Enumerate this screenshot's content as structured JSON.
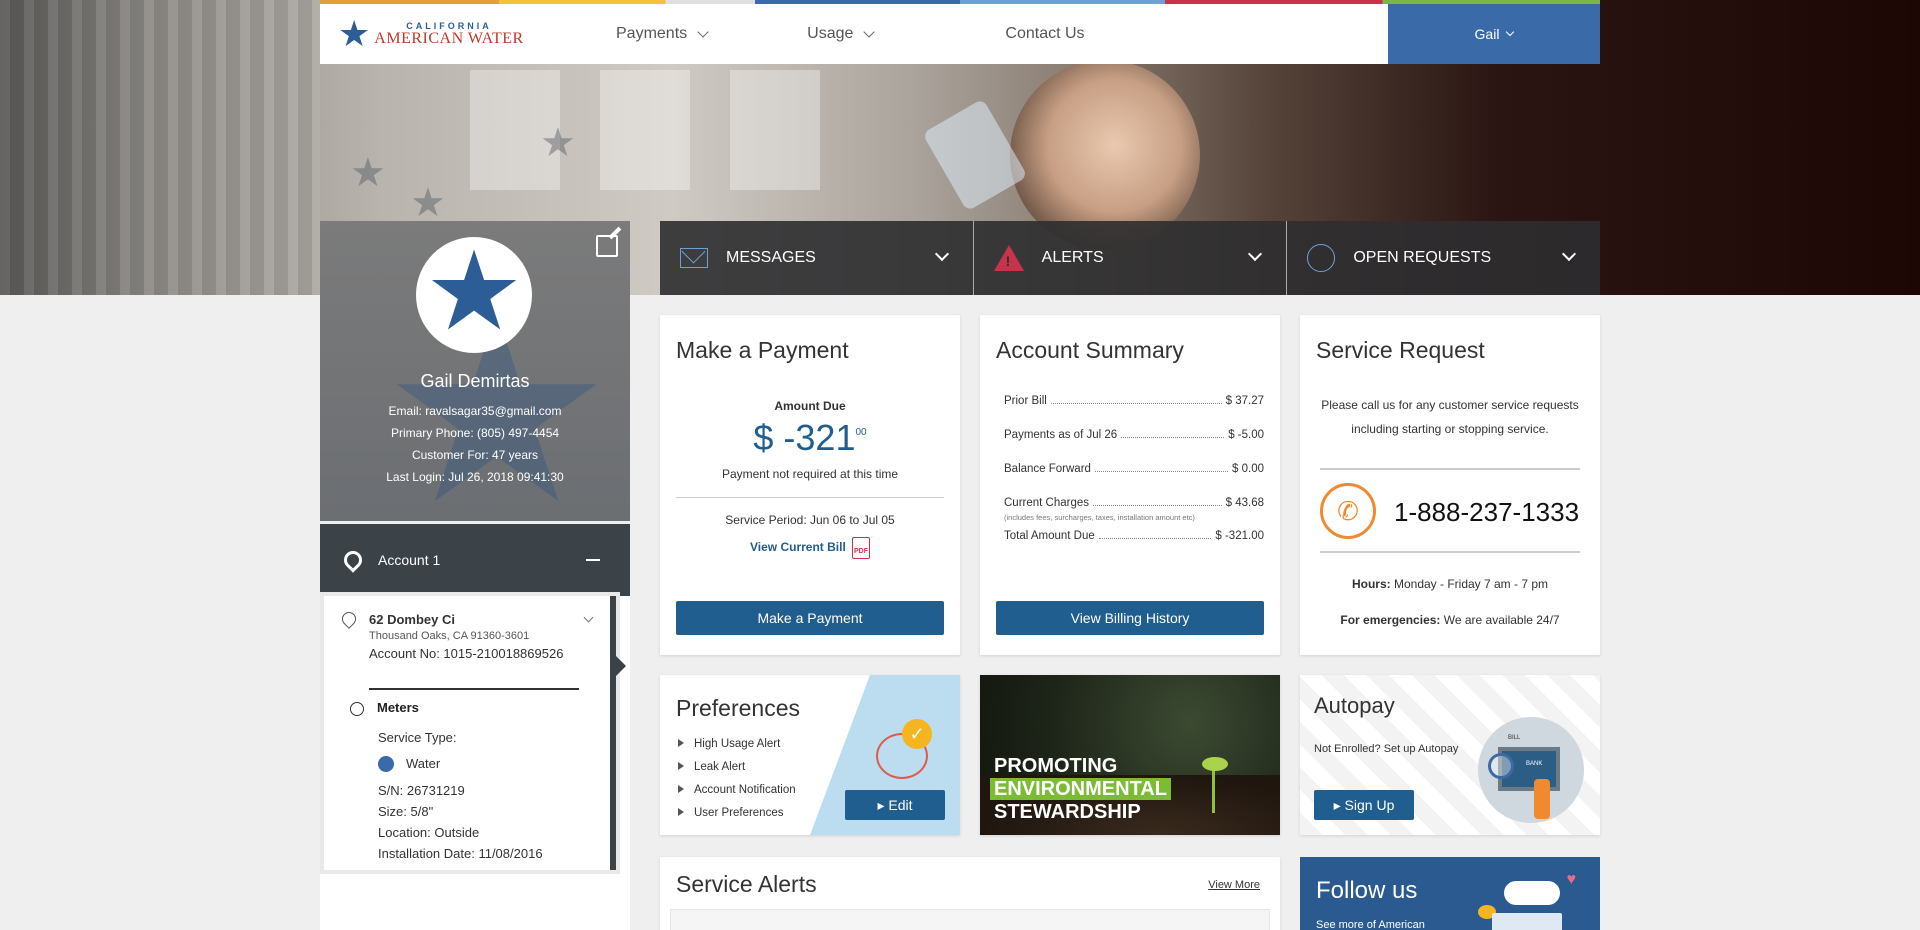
{
  "header": {
    "logo_top": "CALIFORNIA",
    "logo_bottom": "AMERICAN WATER",
    "nav": [
      {
        "label": "Payments"
      },
      {
        "label": "Usage"
      },
      {
        "label": "Contact Us"
      }
    ],
    "user_menu": "Gail"
  },
  "profile": {
    "name": "Gail Demirtas",
    "email": "Email: ravalsagar35@gmail.com",
    "phone": "Primary Phone: (805) 497-4454",
    "customer_for": "Customer For: 47 years",
    "last_login": "Last Login: Jul 26, 2018 09:41:30"
  },
  "account": {
    "header": "Account 1",
    "address_line1": "62 Dombey Ci",
    "address_line2": "Thousand Oaks, CA 91360-3601",
    "account_no": "Account No: 1015-210018869526",
    "meters_label": "Meters",
    "service_type_label": "Service Type:",
    "service_type": "Water",
    "serial": "S/N: 26731219",
    "size": "Size: 5/8\"",
    "location": "Location: Outside",
    "install_date": "Installation Date: 11/08/2016"
  },
  "tabs": [
    {
      "label": "MESSAGES"
    },
    {
      "label": "ALERTS"
    },
    {
      "label": "OPEN REQUESTS"
    }
  ],
  "payment": {
    "title": "Make a Payment",
    "amount_label": "Amount Due",
    "amount_main": "$ -321",
    "amount_cents": "00",
    "note": "Payment not required at this time",
    "period": "Service Period: Jun 06 to Jul 05",
    "view_bill": "View Current Bill",
    "pdf": "PDF",
    "button": "Make a Payment"
  },
  "summary": {
    "title": "Account Summary",
    "rows": [
      {
        "label": "Prior Bill",
        "value": "$ 37.27"
      },
      {
        "label": "Payments as of Jul 26",
        "value": "$ -5.00"
      },
      {
        "label": "Balance Forward",
        "value": "$ 0.00"
      },
      {
        "label": "Current Charges",
        "value": "$ 43.68"
      },
      {
        "label": "Total Amount Due",
        "value": "$ -321.00"
      }
    ],
    "sub_note": "(includes fees, surcharges, taxes, installation amount etc)",
    "button": "View Billing History"
  },
  "service_request": {
    "title": "Service Request",
    "text": "Please call us for any customer service requests including starting or stopping service.",
    "phone": "1-888-237-1333",
    "hours_label": "Hours:",
    "hours": " Monday - Friday 7 am - 7 pm",
    "emerg_label": "For emergencies:",
    "emerg": " We are available 24/7"
  },
  "preferences": {
    "title": "Preferences",
    "items": [
      "High Usage Alert",
      "Leak Alert",
      "Account Notification",
      "User Preferences"
    ],
    "button": "Edit"
  },
  "promo": {
    "line1": "PROMOTING",
    "line2": "ENVIRONMENTAL",
    "line3": "STEWARDSHIP"
  },
  "autopay": {
    "title": "Autopay",
    "text": "Not Enrolled? Set up Autopay",
    "button": "Sign Up",
    "illus_bill": "BILL",
    "illus_bank": "BANK"
  },
  "service_alerts": {
    "title": "Service Alerts",
    "more": "View More"
  },
  "follow": {
    "title": "Follow us",
    "text": "See more of American"
  },
  "colors": {
    "brand_blue": "#3a6aa8",
    "button_blue": "#1f5e8e",
    "alert_red": "#c9324b",
    "accent_orange": "#f0892f"
  }
}
